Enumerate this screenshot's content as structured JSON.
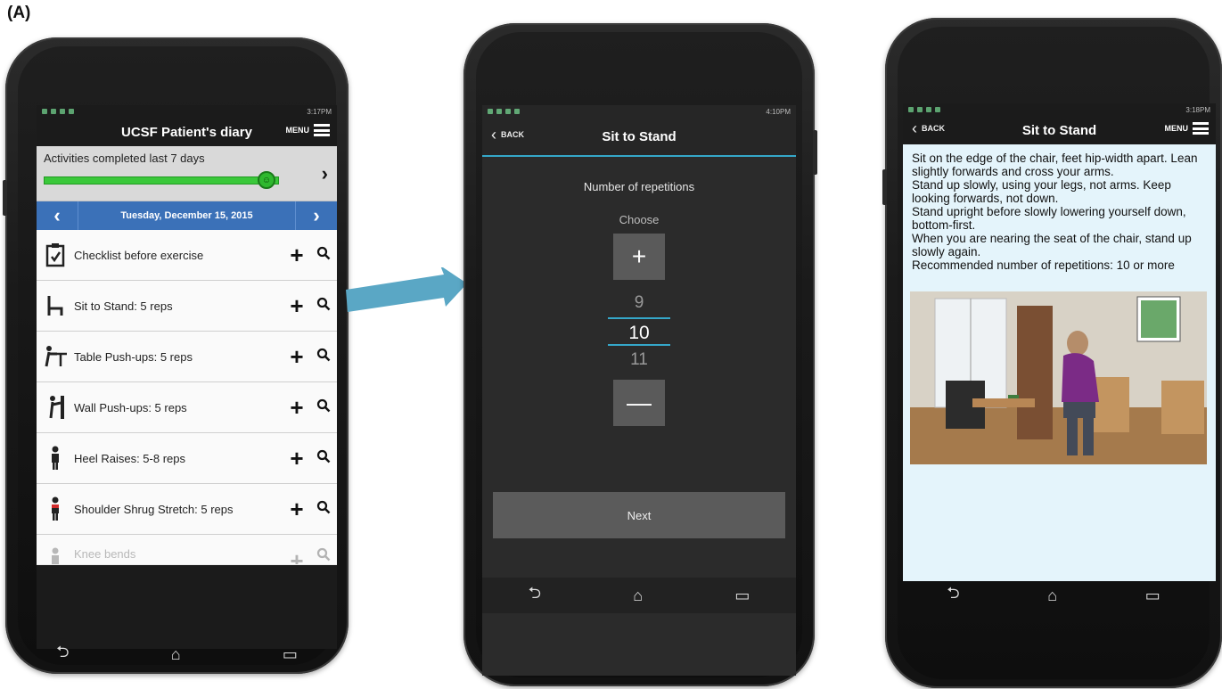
{
  "figure_label": "(A)",
  "phone1": {
    "status_time": "3:17PM",
    "title": "UCSF Patient's diary",
    "menu_label": "MENU",
    "progress": {
      "title": "Activities completed last 7 days",
      "level": 1.0
    },
    "date": "Tuesday, December 15, 2015",
    "exercises": [
      {
        "label": "Checklist before exercise",
        "icon": "clipboard-icon"
      },
      {
        "label": "Sit to Stand: 5 reps",
        "icon": "chair-icon"
      },
      {
        "label": "Table Push-ups: 5 reps",
        "icon": "table-pushup-icon"
      },
      {
        "label": "Wall Push-ups: 5 reps",
        "icon": "wall-pushup-icon"
      },
      {
        "label": "Heel Raises: 5-8 reps",
        "icon": "person-icon"
      },
      {
        "label": "Shoulder Shrug Stretch: 5 reps",
        "icon": "person-red-icon"
      },
      {
        "label": "Knee bends",
        "icon": "person-icon"
      }
    ]
  },
  "phone2": {
    "status_time": "4:10PM",
    "back_label": "BACK",
    "title": "Sit to Stand",
    "prompt": "Number of repetitions",
    "choose_label": "Choose",
    "plus": "+",
    "minus": "—",
    "numbers": {
      "prev": "9",
      "selected": "10",
      "next": "11"
    },
    "next_label": "Next"
  },
  "phone3": {
    "status_time": "3:18PM",
    "back_label": "BACK",
    "title": "Sit to Stand",
    "menu_label": "MENU",
    "instructions": [
      "Sit on the edge of the chair, feet hip-width apart. Lean slightly forwards and cross your arms.",
      "Stand up slowly, using your legs, not arms. Keep looking forwards, not down.",
      "Stand upright before slowly lowering yourself down, bottom-first.",
      "When you are nearing the seat of the chair, stand up slowly again.",
      "Recommended number of repetitions: 10 or more"
    ]
  },
  "colors": {
    "accent_blue": "#3b71b8",
    "progress_green": "#3ac83a",
    "arrow_teal": "#5aa7c5",
    "divider_cyan": "#35a7c9"
  }
}
